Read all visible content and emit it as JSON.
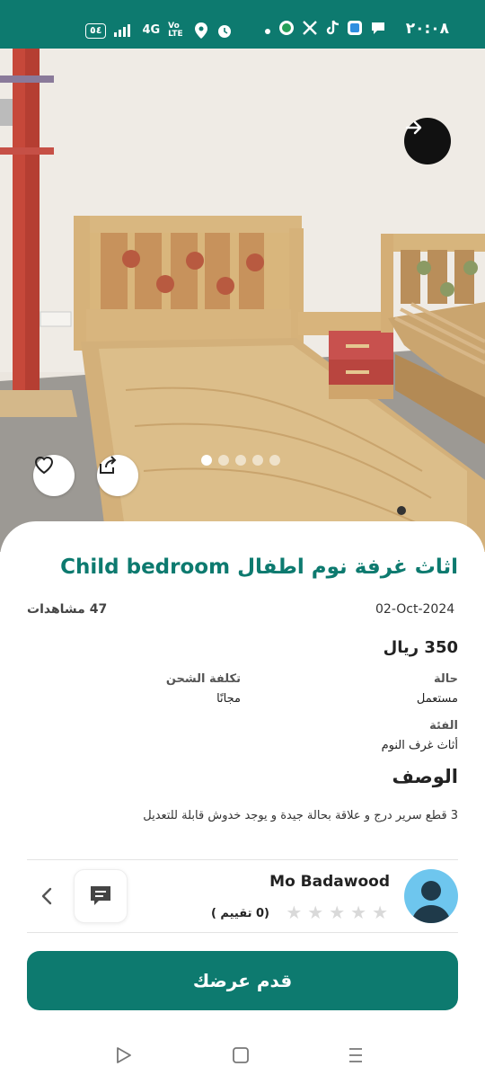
{
  "status_bar": {
    "time": "٢٠:٠٨",
    "battery": "٥٤",
    "network": "4G",
    "volte": "Vo LTE"
  },
  "listing": {
    "title": "اثاث غرفة نوم اطفال Child bedroom",
    "date": "02-Oct-2024",
    "views": "47 مشاهدات",
    "price": "350 ريال",
    "shipping_label": "تكلفة الشحن",
    "shipping_value": "مجانًا",
    "condition_label": "حالة",
    "condition_value": "مستعمل",
    "category_label": "الفئة",
    "category_value": "أثاث غرف النوم",
    "description_title": "الوصف",
    "description": "3 قطع سرير درج و علاقة بحالة جيدة و يوجد خدوش قابلة للتعديل"
  },
  "gallery": {
    "image_count": 5,
    "active_index": 0
  },
  "seller": {
    "name": "Mo Badawood",
    "rating_text": "(0 تقييم )",
    "rating": 0,
    "max_rating": 5
  },
  "actions": {
    "offer_button": "قدم عرضك"
  },
  "colors": {
    "primary": "#0d7a6f"
  }
}
